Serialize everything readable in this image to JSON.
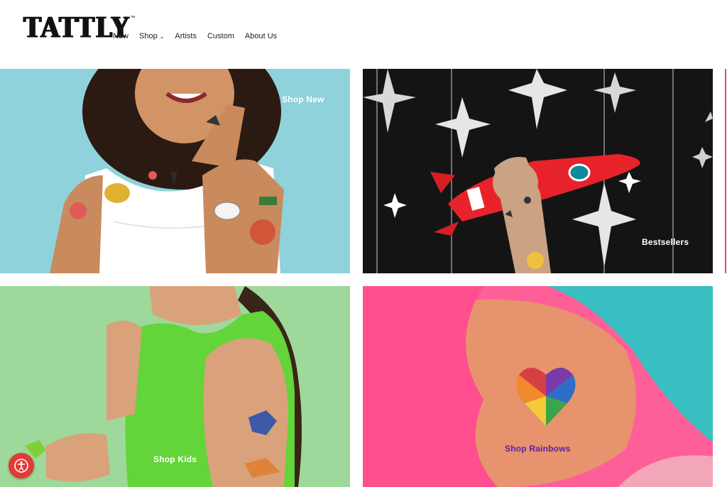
{
  "brand": {
    "name": "TATTLY",
    "trademark": "™"
  },
  "nav": {
    "items": [
      {
        "label": "New"
      },
      {
        "label": "Shop"
      },
      {
        "label": "Artists"
      },
      {
        "label": "Custom"
      },
      {
        "label": "About Us"
      }
    ]
  },
  "tiles": {
    "shop_new": {
      "label": "Shop New",
      "bg_color": "#8fd2dc"
    },
    "bestsellers": {
      "label": "Bestsellers",
      "bg_color": "#141414"
    },
    "shop_kids": {
      "label": "Shop Kids",
      "bg_color": "#9ed89a"
    },
    "shop_rainbows": {
      "label": "Shop Rainbows",
      "bg_color": "#ff5f98"
    }
  },
  "colors": {
    "accent": "#e23a36",
    "rainbow_label": "#5b1fa6"
  },
  "icons": {
    "badge": "accessibility-icon",
    "nav_chevron": "chevron-down-icon"
  }
}
